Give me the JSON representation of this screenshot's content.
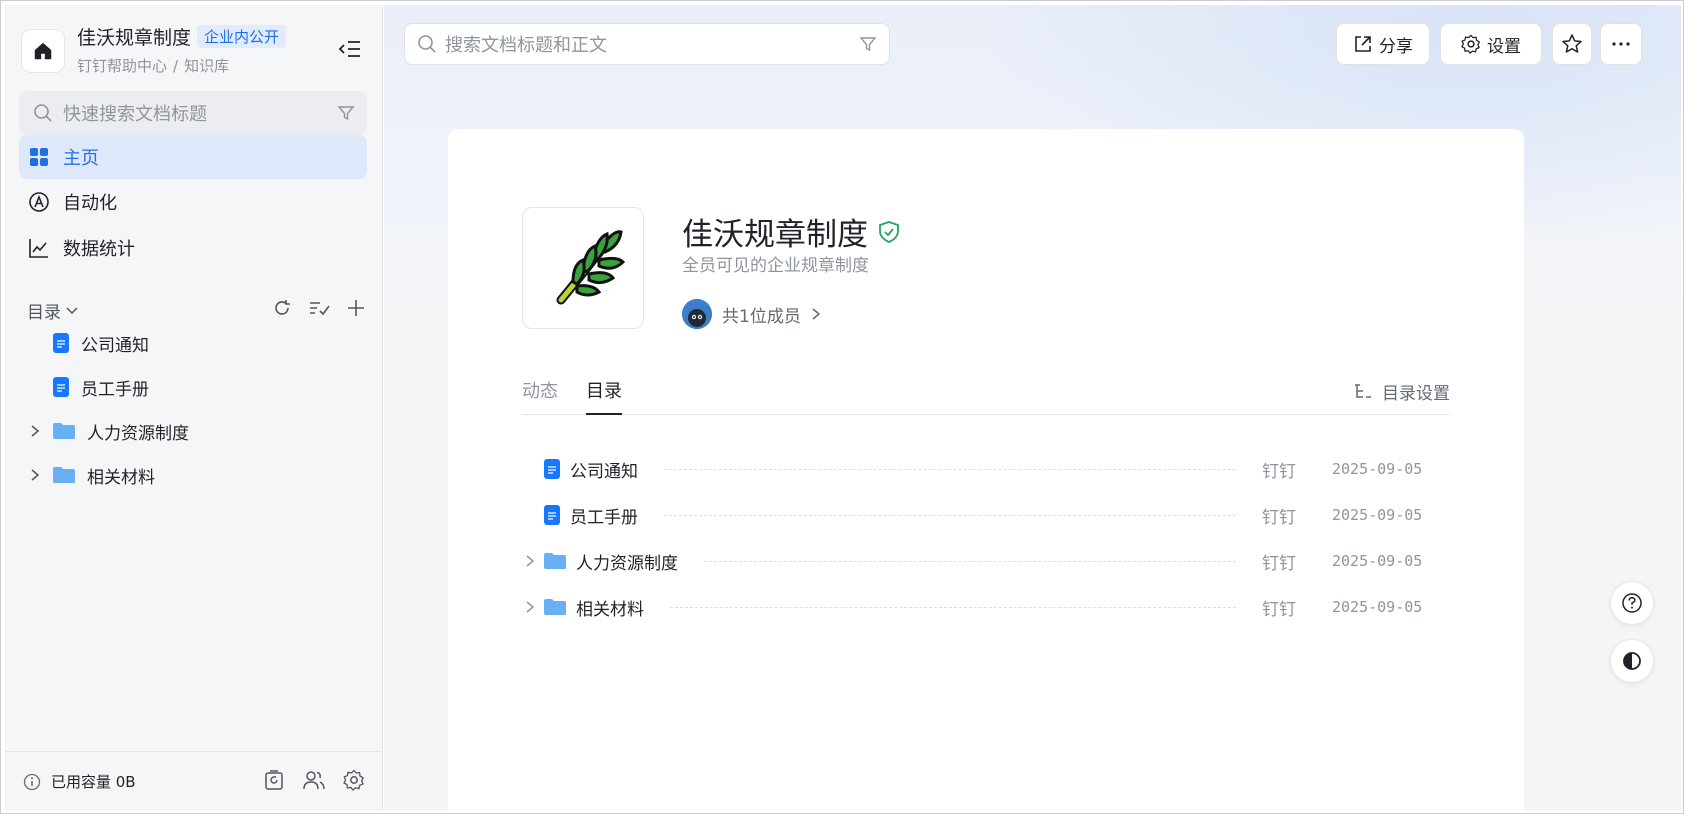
{
  "sidebar": {
    "kb_title": "佳沃规章制度",
    "kb_badge": "企业内公开",
    "breadcrumb": [
      "钉钉帮助中心",
      "知识库"
    ],
    "breadcrumb_sep": "/",
    "search_placeholder": "快速搜索文档标题",
    "nav": [
      {
        "label": "主页",
        "icon": "grid-icon",
        "active": true
      },
      {
        "label": "自动化",
        "icon": "automation-icon"
      },
      {
        "label": "数据统计",
        "icon": "chart-icon"
      }
    ],
    "toc_label": "目录",
    "tree": [
      {
        "label": "公司通知",
        "type": "doc"
      },
      {
        "label": "员工手册",
        "type": "doc"
      },
      {
        "label": "人力资源制度",
        "type": "folder"
      },
      {
        "label": "相关材料",
        "type": "folder"
      }
    ],
    "capacity": "已用容量 0B"
  },
  "topbar": {
    "search_placeholder": "搜索文档标题和正文",
    "share_label": "分享",
    "settings_label": "设置"
  },
  "kb": {
    "name": "佳沃规章制度",
    "description": "全员可见的企业规章制度",
    "members": "共1位成员"
  },
  "tabs": [
    {
      "label": "动态",
      "active": false
    },
    {
      "label": "目录",
      "active": true
    }
  ],
  "toc_settings_label": "目录设置",
  "toc_rows": [
    {
      "name": "公司通知",
      "type": "doc",
      "owner": "钉钉",
      "date": "2025-09-05"
    },
    {
      "name": "员工手册",
      "type": "doc",
      "owner": "钉钉",
      "date": "2025-09-05"
    },
    {
      "name": "人力资源制度",
      "type": "folder",
      "owner": "钉钉",
      "date": "2025-09-05"
    },
    {
      "name": "相关材料",
      "type": "folder",
      "owner": "钉钉",
      "date": "2025-09-05"
    }
  ],
  "colors": {
    "accent": "#1f6fe5",
    "doc_icon": "#1677ff",
    "folder_icon": "#69aff4",
    "verified": "#23a55a"
  }
}
